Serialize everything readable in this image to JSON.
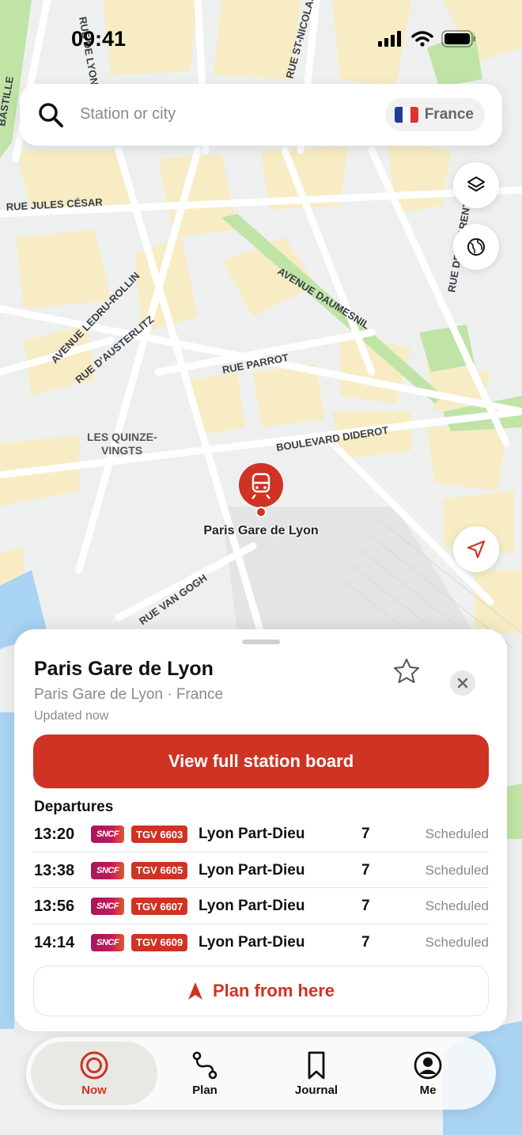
{
  "status_bar": {
    "time": "09:41"
  },
  "search": {
    "placeholder": "Station or city",
    "country": "France"
  },
  "map": {
    "street_labels": [
      "RUE JULES CÉSAR",
      "AVENUE LEDRU-ROLLIN",
      "RUE D'AUSTERLITZ",
      "RUE PARROT",
      "AVENUE DAUMESNIL",
      "BOULEVARD DIDEROT",
      "LES QUINZE-",
      "VINGTS",
      "RUE VAN GOGH",
      "RUE DE LYON",
      "RUE ST-NICOLAS",
      "RUE DE CHARENTON",
      "BASTILLE"
    ],
    "station_pin_label": "Paris Gare de Lyon"
  },
  "sheet": {
    "title": "Paris Gare de Lyon",
    "subtitle": "Paris Gare de Lyon · France",
    "updated": "Updated now",
    "board_button": "View full station board",
    "departures_heading": "Departures",
    "departures": [
      {
        "time": "13:20",
        "operator": "SNCF",
        "train": "TGV 6603",
        "destination": "Lyon Part-Dieu",
        "platform": "7",
        "status": "Scheduled"
      },
      {
        "time": "13:38",
        "operator": "SNCF",
        "train": "TGV 6605",
        "destination": "Lyon Part-Dieu",
        "platform": "7",
        "status": "Scheduled"
      },
      {
        "time": "13:56",
        "operator": "SNCF",
        "train": "TGV 6607",
        "destination": "Lyon Part-Dieu",
        "platform": "7",
        "status": "Scheduled"
      },
      {
        "time": "14:14",
        "operator": "SNCF",
        "train": "TGV 6609",
        "destination": "Lyon Part-Dieu",
        "platform": "7",
        "status": "Scheduled"
      }
    ],
    "plan_button": "Plan from here"
  },
  "tabs": [
    {
      "label": "Now",
      "icon": "target-icon",
      "active": true
    },
    {
      "label": "Plan",
      "icon": "route-icon",
      "active": false
    },
    {
      "label": "Journal",
      "icon": "bookmark-icon",
      "active": false
    },
    {
      "label": "Me",
      "icon": "person-icon",
      "active": false
    }
  ],
  "colors": {
    "accent": "#cf3324",
    "map_block": "#f7ecc4",
    "map_road": "#ffffff",
    "map_park": "#bfe4a6",
    "water": "#a9d3f2"
  }
}
